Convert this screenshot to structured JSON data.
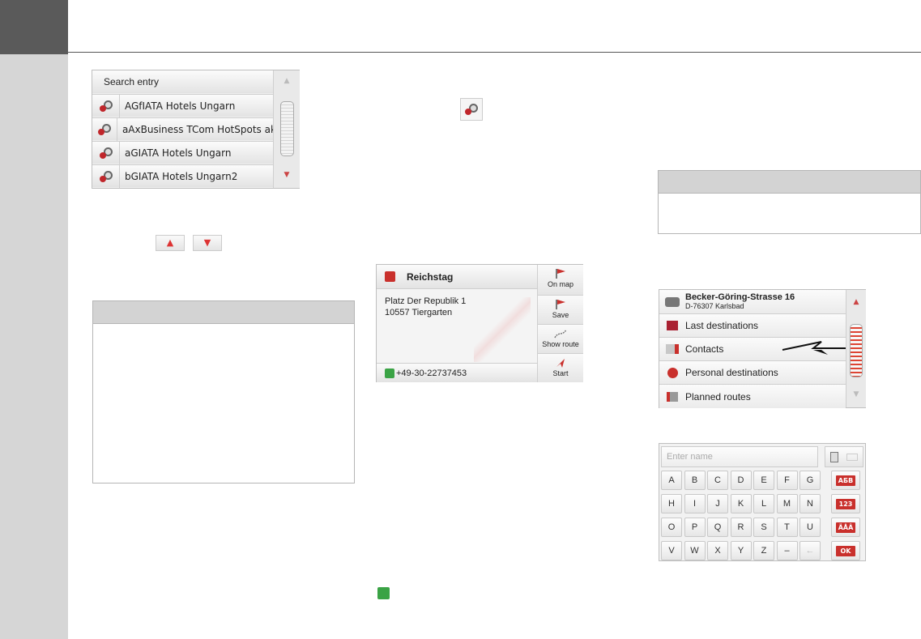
{
  "search_list": {
    "title": "Search entry",
    "items": [
      {
        "label": "AGfIATA Hotels Ungarn"
      },
      {
        "label": "aAxBusiness TCom HotSpots aktiv"
      },
      {
        "label": "aGIATA Hotels Ungarn"
      },
      {
        "label": "bGIATA Hotels Ungarn2"
      }
    ]
  },
  "poi_detail": {
    "name": "Reichstag",
    "address_line1": "Platz Der Republik 1",
    "address_line2": "10557 Tiergarten",
    "phone": "+49-30-22737453",
    "buttons": {
      "on_map": "On map",
      "save": "Save",
      "show_route": "Show route",
      "start": "Start"
    }
  },
  "destination_menu": {
    "current_street": "Becker-Göring-Strasse 16",
    "current_city": "D-76307 Karlsbad",
    "items": [
      {
        "label": "Last destinations"
      },
      {
        "label": "Contacts"
      },
      {
        "label": "Personal destinations"
      },
      {
        "label": "Planned routes"
      }
    ]
  },
  "keyboard": {
    "placeholder": "Enter name",
    "rows": [
      [
        "A",
        "B",
        "C",
        "D",
        "E",
        "F",
        "G"
      ],
      [
        "H",
        "I",
        "J",
        "K",
        "L",
        "M",
        "N"
      ],
      [
        "O",
        "P",
        "Q",
        "R",
        "S",
        "T",
        "U"
      ],
      [
        "V",
        "W",
        "X",
        "Y",
        "Z",
        "–",
        "←"
      ]
    ],
    "function_keys": [
      "АБВ",
      "123",
      "ÄÅÂ",
      "OK"
    ]
  },
  "colors": {
    "sidebar": "#d6d6d6",
    "corner": "#5a5a5a",
    "accent_red": "#c9302c"
  },
  "icons": {
    "poi_pin": "poi-pin-icon",
    "phone": "phone-icon",
    "up": "arrow-up-icon",
    "down": "arrow-down-icon"
  }
}
